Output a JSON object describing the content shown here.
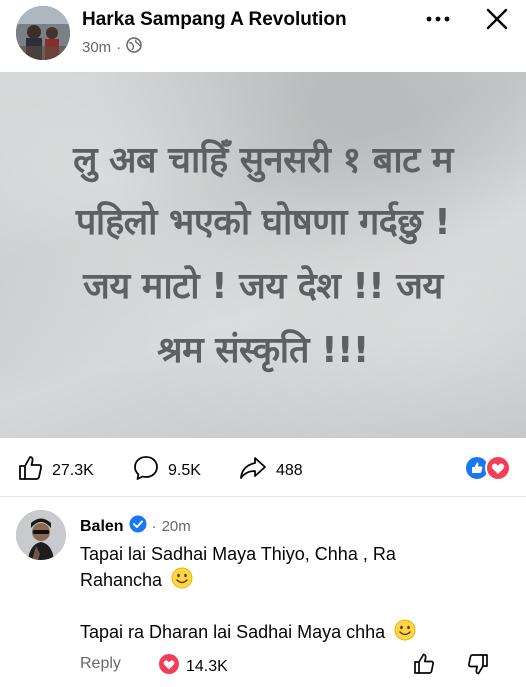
{
  "post": {
    "author": "Harka Sampang A Revolution",
    "time": "30m",
    "separator": "·",
    "image_text": [
      "लु अब चाहिँ सुनसरी १ बाट म",
      "पहिलो भएको घोषणा गर्दछु !",
      "जय माटो ! जय देश !! जय",
      "श्रम संस्कृति !!!"
    ]
  },
  "stats": {
    "likes": "27.3K",
    "comments": "9.5K",
    "shares": "488"
  },
  "comment": {
    "author": "Balen",
    "separator": "·",
    "time": "20m",
    "lines": [
      "Tapai lai Sadhai Maya Thiyo, Chha , Ra",
      "Rahancha",
      "Tapai ra Dharan lai Sadhai Maya chha"
    ],
    "reply_label": "Reply",
    "reaction_count": "14.3K"
  },
  "colors": {
    "facebook_blue": "#1877F2",
    "love_red": "#F33E58",
    "secondary_text": "#65676B"
  },
  "icons": [
    "globe-icon",
    "more-icon",
    "close-icon",
    "like-icon",
    "comment-icon",
    "share-icon",
    "verified-icon",
    "smile-emoji-icon",
    "heart-icon",
    "dislike-icon"
  ]
}
